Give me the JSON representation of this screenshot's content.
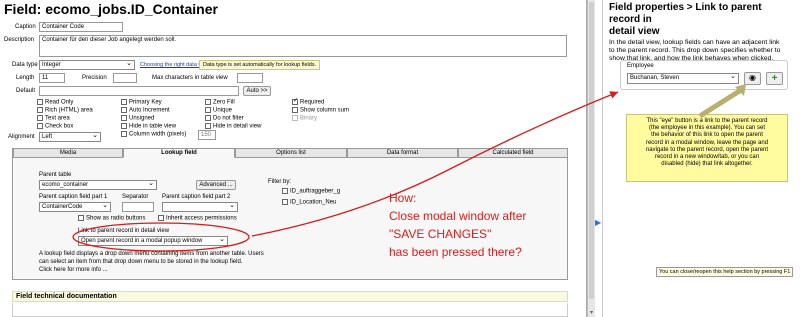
{
  "header": {
    "title": "Field: ecomo_jobs.ID_Container"
  },
  "form": {
    "caption_label": "Caption",
    "caption_value": "Container Code",
    "description_label": "Description",
    "description_value": "Container für den dieser Job angelegt werden soll.",
    "datatype_label": "Data type",
    "datatype_value": "Integer",
    "datatype_link": "Choosing the right data type",
    "datatype_note": "Data type is set automatically for lookup fields.",
    "length_label": "Length",
    "length_value": "11",
    "precision_label": "Precision",
    "maxchars_label": "Max characters in table view",
    "default_label": "Default",
    "auto_button": "Auto >>",
    "alignment_label": "Alignment",
    "alignment_value": "Left",
    "checkboxes": [
      {
        "label": "Read Only",
        "checked": false
      },
      {
        "label": "Rich (HTML) area",
        "checked": false
      },
      {
        "label": "Text area",
        "checked": false
      },
      {
        "label": "Check box",
        "checked": false
      },
      {
        "label": "Primary Key",
        "checked": false
      },
      {
        "label": "Auto Increment",
        "checked": false
      },
      {
        "label": "Unsigned",
        "checked": false
      },
      {
        "label": "Hide in table view",
        "checked": false
      },
      {
        "label": "Column width (pixels)",
        "checked": false
      },
      {
        "label": "Zero Fill",
        "checked": false
      },
      {
        "label": "Unique",
        "checked": false
      },
      {
        "label": "Do not filter",
        "checked": false
      },
      {
        "label": "Hide in detail view",
        "checked": false
      },
      {
        "label": "Required",
        "checked": true
      },
      {
        "label": "Show column sum",
        "checked": false
      },
      {
        "label": "Binary",
        "checked": false
      }
    ],
    "column_width_value": "150"
  },
  "tabs": [
    {
      "label": "Media"
    },
    {
      "label": "Lookup field"
    },
    {
      "label": "Options list"
    },
    {
      "label": "Data format"
    },
    {
      "label": "Calculated field"
    }
  ],
  "lookup": {
    "parent_table_label": "Parent table",
    "parent_table_value": "ecomo_container",
    "advanced_button": "Advanced ...",
    "caption_part1_label": "Parent caption field part 1",
    "caption_part1_value": "ContainerCode",
    "separator_label": "Separator",
    "caption_part2_label": "Parent caption field part 2",
    "show_radio_label": "Show as radio buttons",
    "inherit_label": "Inherit access permissions",
    "link_label": "Link to parent record in detail view",
    "link_value": "Open parent record in a modal popup window",
    "info_line1": "A lookup field displays a drop down menu containing items from another table. Users",
    "info_line2": "can select an item from that drop down menu to be stored in the lookup field.",
    "info_line3": "Click here for more info ...",
    "filter_label": "Filter by:",
    "filter_items": [
      "ID_auftraggeber_g",
      "ID_Location_Neu"
    ]
  },
  "annotation": {
    "line1": "How:",
    "line2": "Close modal window after",
    "line3": "\"SAVE CHANGES\"",
    "line4": "has been pressed there?"
  },
  "section": {
    "technical_doc": "Field technical documentation"
  },
  "help": {
    "title_line1": "Field properties > Link to parent record in",
    "title_line2": "detail view",
    "text_line1": "In the detail view, lookup fields can have an adjacent link",
    "text_line2": "to the parent record. This drop down specifies whether to",
    "text_line3": "show that link, and how the link behaves when clicked.",
    "employee_label": "Employee",
    "employee_value": "Buchanan, Steven",
    "callout_lines": [
      "This \"eye\" button is a link to the parent record",
      "(the employee in this example). You can set",
      "the behavior of this link to open the parent",
      "record in a modal window, leave the page and",
      "navigate to the parent record, open the parent",
      "record in a new window/tab, or you can",
      "disabled (hide) that link altogether."
    ],
    "tooltip": "You can close/reopen this help section by pressing F1"
  },
  "colors": {
    "annotation_red": "#e01b1b",
    "arrow_red": "#d41c1c",
    "callout_yellow": "#fffb9e",
    "add_green": "#2e8b2e"
  }
}
